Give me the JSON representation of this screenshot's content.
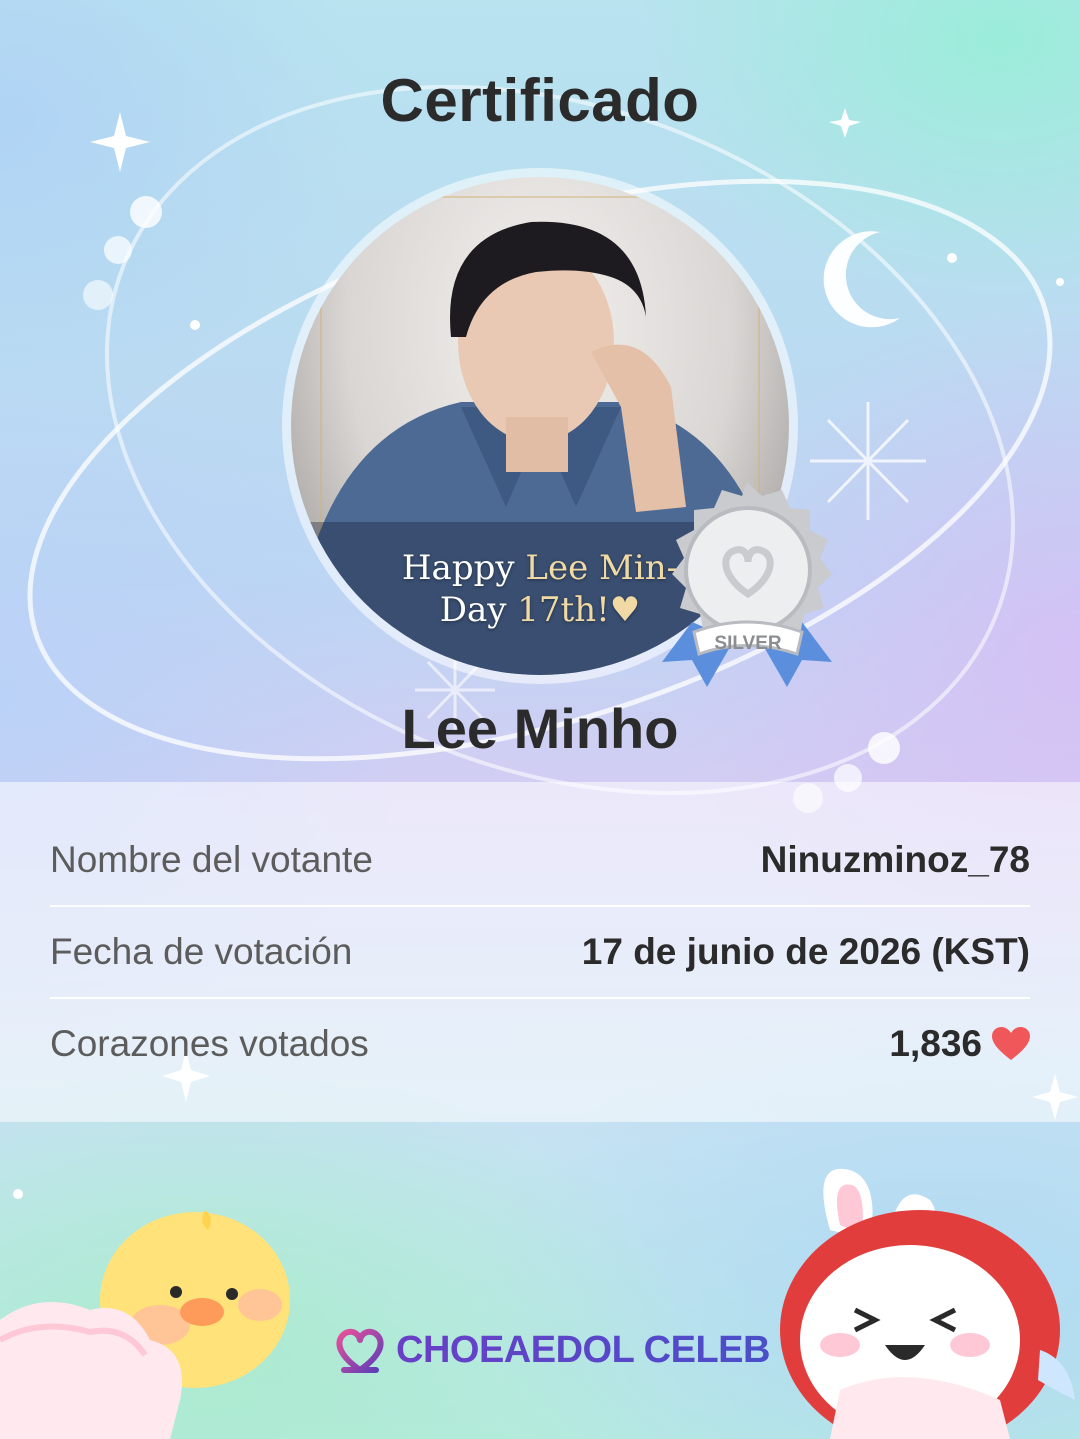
{
  "certificate": {
    "title": "Certificado",
    "celebrity_name": "Lee Minho",
    "photo_caption_line1_a": "Happy ",
    "photo_caption_line1_b": "Lee Min-",
    "photo_caption_line2_a": "Day ",
    "photo_caption_line2_b": "17th!",
    "badge_label": "SILVER"
  },
  "info": {
    "rows": [
      {
        "label": "Nombre del votante",
        "value": "Ninuzminoz_78"
      },
      {
        "label": "Fecha de votación",
        "value": "17 de junio de 2026 (KST)"
      },
      {
        "label": "Corazones votados",
        "value": "1,836"
      }
    ]
  },
  "brand": {
    "name": "CHOEAEDOL CELEB"
  },
  "icons": {
    "votes": "heart-icon",
    "badge": "silver-medal-icon",
    "brand_logo": "choeaedol-logo-icon"
  },
  "colors": {
    "heart": "#f0575a",
    "brand": "#5a3db8",
    "badge_ribbon": "#6fa6e6",
    "title_text": "#2b2b2b"
  }
}
